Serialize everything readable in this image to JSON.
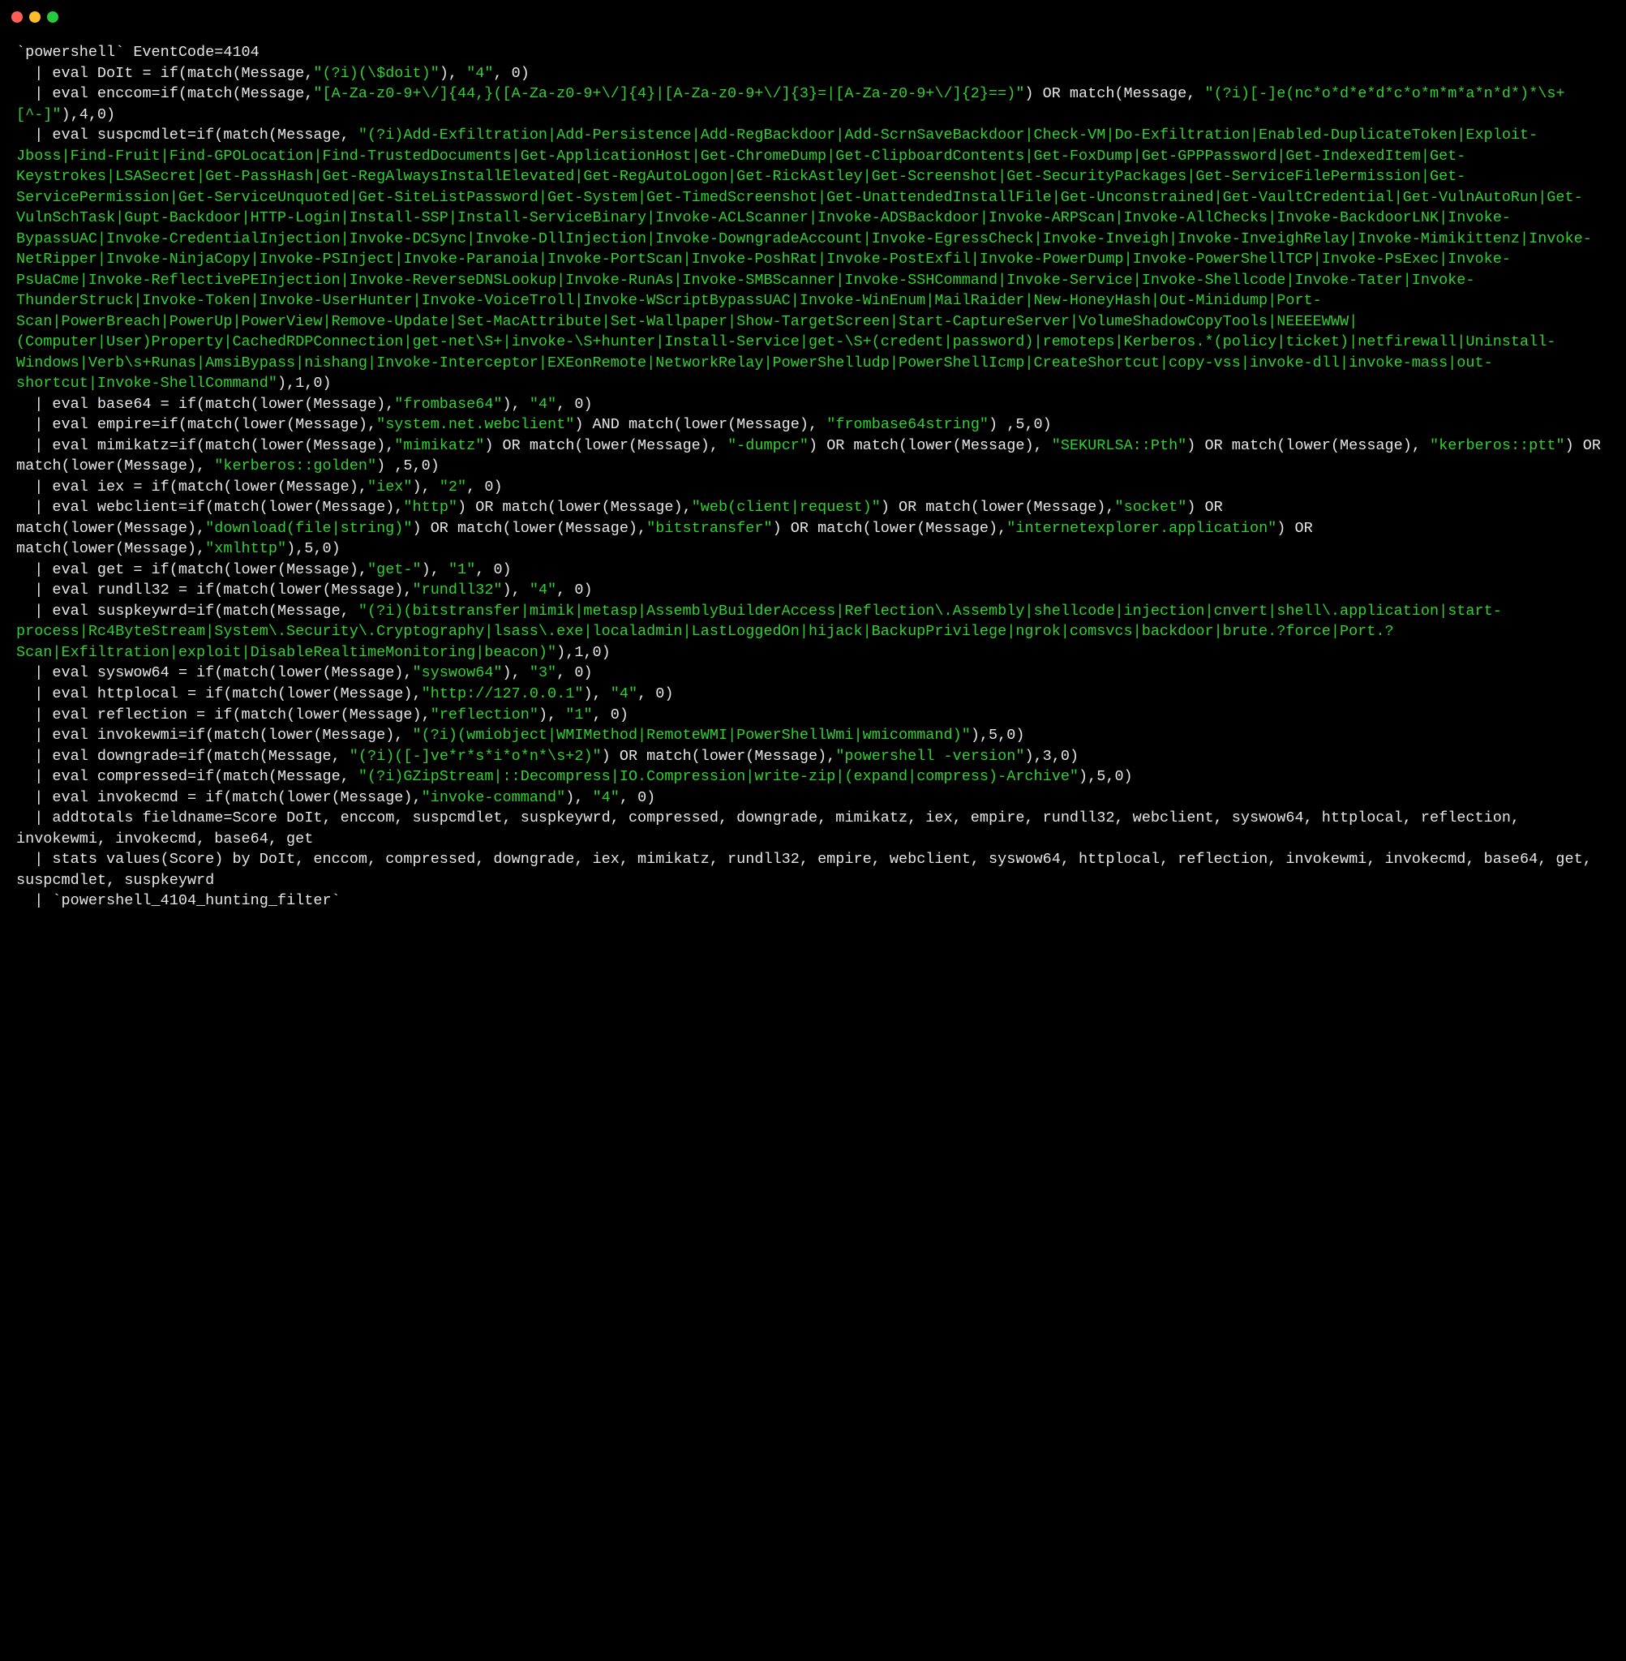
{
  "titlebar": {
    "close_name": "close",
    "min_name": "minimize",
    "max_name": "maximize"
  },
  "code": {
    "l1": "`powershell` EventCode=4104",
    "l2a": "  | eval DoIt = if(match(Message,",
    "l2q": "\"(?i)(\\$doit)\"",
    "l2b": "), ",
    "l2c": "\"4\"",
    "l2d": ", 0)",
    "l3a": "  | eval enccom=if(match(Message,",
    "l3q": "\"[A-Za-z0-9+\\/]{44,}([A-Za-z0-9+\\/]{4}|[A-Za-z0-9+\\/]{3}=|[A-Za-z0-9+\\/]{2}==)\"",
    "l3b": ") OR match(Message, ",
    "l3r": "\"(?i)[-]e(nc*o*d*e*d*c*o*m*m*a*n*d*)*\\s+[^-]\"",
    "l3c": "),4,0)",
    "l4a": "  | eval suspcmdlet=if(match(Message, ",
    "l4q": "\"(?i)Add-Exfiltration|Add-Persistence|Add-RegBackdoor|Add-ScrnSaveBackdoor|Check-VM|Do-Exfiltration|Enabled-DuplicateToken|Exploit-Jboss|Find-Fruit|Find-GPOLocation|Find-TrustedDocuments|Get-ApplicationHost|Get-ChromeDump|Get-ClipboardContents|Get-FoxDump|Get-GPPPassword|Get-IndexedItem|Get-Keystrokes|LSASecret|Get-PassHash|Get-RegAlwaysInstallElevated|Get-RegAutoLogon|Get-RickAstley|Get-Screenshot|Get-SecurityPackages|Get-ServiceFilePermission|Get-ServicePermission|Get-ServiceUnquoted|Get-SiteListPassword|Get-System|Get-TimedScreenshot|Get-UnattendedInstallFile|Get-Unconstrained|Get-VaultCredential|Get-VulnAutoRun|Get-VulnSchTask|Gupt-Backdoor|HTTP-Login|Install-SSP|Install-ServiceBinary|Invoke-ACLScanner|Invoke-ADSBackdoor|Invoke-ARPScan|Invoke-AllChecks|Invoke-BackdoorLNK|Invoke-BypassUAC|Invoke-CredentialInjection|Invoke-DCSync|Invoke-DllInjection|Invoke-DowngradeAccount|Invoke-EgressCheck|Invoke-Inveigh|Invoke-InveighRelay|Invoke-Mimikittenz|Invoke-NetRipper|Invoke-NinjaCopy|Invoke-PSInject|Invoke-Paranoia|Invoke-PortScan|Invoke-PoshRat|Invoke-PostExfil|Invoke-PowerDump|Invoke-PowerShellTCP|Invoke-PsExec|Invoke-PsUaCme|Invoke-ReflectivePEInjection|Invoke-ReverseDNSLookup|Invoke-RunAs|Invoke-SMBScanner|Invoke-SSHCommand|Invoke-Service|Invoke-Shellcode|Invoke-Tater|Invoke-ThunderStruck|Invoke-Token|Invoke-UserHunter|Invoke-VoiceTroll|Invoke-WScriptBypassUAC|Invoke-WinEnum|MailRaider|New-HoneyHash|Out-Minidump|Port-Scan|PowerBreach|PowerUp|PowerView|Remove-Update|Set-MacAttribute|Set-Wallpaper|Show-TargetScreen|Start-CaptureServer|VolumeShadowCopyTools|NEEEEWWW|(Computer|User)Property|CachedRDPConnection|get-net\\S+|invoke-\\S+hunter|Install-Service|get-\\S+(credent|password)|remoteps|Kerberos.*(policy|ticket)|netfirewall|Uninstall-Windows|Verb\\s+Runas|AmsiBypass|nishang|Invoke-Interceptor|EXEonRemote|NetworkRelay|PowerShelludp|PowerShellIcmp|CreateShortcut|copy-vss|invoke-dll|invoke-mass|out-shortcut|Invoke-ShellCommand\"",
    "l4b": "),1,0)",
    "l5a": "  | eval base64 = if(match(lower(Message),",
    "l5q": "\"frombase64\"",
    "l5b": "), ",
    "l5c": "\"4\"",
    "l5d": ", 0)",
    "l6a": "  | eval empire=if(match(lower(Message),",
    "l6q": "\"system.net.webclient\"",
    "l6b": ") AND match(lower(Message), ",
    "l6r": "\"frombase64string\"",
    "l6c": ") ,5,0)",
    "l7a": "  | eval mimikatz=if(match(lower(Message),",
    "l7q": "\"mimikatz\"",
    "l7b": ") OR match(lower(Message), ",
    "l7r": "\"-dumpcr\"",
    "l7c": ") OR match(lower(Message), ",
    "l7s": "\"SEKURLSA::Pth\"",
    "l7d": ") OR match(lower(Message), ",
    "l7t": "\"kerberos::ptt\"",
    "l7e": ") OR match(lower(Message), ",
    "l7u": "\"kerberos::golden\"",
    "l7f": ") ,5,0)",
    "l8a": "  | eval iex = if(match(lower(Message),",
    "l8q": "\"iex\"",
    "l8b": "), ",
    "l8c": "\"2\"",
    "l8d": ", 0)",
    "l9a": "  | eval webclient=if(match(lower(Message),",
    "l9q": "\"http\"",
    "l9b": ") OR match(lower(Message),",
    "l9r": "\"web(client|request)\"",
    "l9c": ") OR match(lower(Message),",
    "l9s": "\"socket\"",
    "l9d": ") OR match(lower(Message),",
    "l9t": "\"download(file|string)\"",
    "l9e": ") OR match(lower(Message),",
    "l9u": "\"bitstransfer\"",
    "l9f": ") OR match(lower(Message),",
    "l9v": "\"internetexplorer.application\"",
    "l9g": ") OR match(lower(Message),",
    "l9w": "\"xmlhttp\"",
    "l9h": "),5,0)",
    "l10a": "  | eval get = if(match(lower(Message),",
    "l10q": "\"get-\"",
    "l10b": "), ",
    "l10c": "\"1\"",
    "l10d": ", 0)",
    "l11a": "  | eval rundll32 = if(match(lower(Message),",
    "l11q": "\"rundll32\"",
    "l11b": "), ",
    "l11c": "\"4\"",
    "l11d": ", 0)",
    "l12a": "  | eval suspkeywrd=if(match(Message, ",
    "l12q": "\"(?i)(bitstransfer|mimik|metasp|AssemblyBuilderAccess|Reflection\\.Assembly|shellcode|injection|cnvert|shell\\.application|start-process|Rc4ByteStream|System\\.Security\\.Cryptography|lsass\\.exe|localadmin|LastLoggedOn|hijack|BackupPrivilege|ngrok|comsvcs|backdoor|brute.?force|Port.?Scan|Exfiltration|exploit|DisableRealtimeMonitoring|beacon)\"",
    "l12b": "),1,0)",
    "l13a": "  | eval syswow64 = if(match(lower(Message),",
    "l13q": "\"syswow64\"",
    "l13b": "), ",
    "l13c": "\"3\"",
    "l13d": ", 0)",
    "l14a": "  | eval httplocal = if(match(lower(Message),",
    "l14q": "\"http://127.0.0.1\"",
    "l14b": "), ",
    "l14c": "\"4\"",
    "l14d": ", 0)",
    "l15a": "  | eval reflection = if(match(lower(Message),",
    "l15q": "\"reflection\"",
    "l15b": "), ",
    "l15c": "\"1\"",
    "l15d": ", 0)",
    "l16a": "  | eval invokewmi=if(match(lower(Message), ",
    "l16q": "\"(?i)(wmiobject|WMIMethod|RemoteWMI|PowerShellWmi|wmicommand)\"",
    "l16b": "),5,0)",
    "l17a": "  | eval downgrade=if(match(Message, ",
    "l17q": "\"(?i)([-]ve*r*s*i*o*n*\\s+2)\"",
    "l17b": ") OR match(lower(Message),",
    "l17r": "\"powershell -version\"",
    "l17c": "),3,0)",
    "l18a": "  | eval compressed=if(match(Message, ",
    "l18q": "\"(?i)GZipStream|::Decompress|IO.Compression|write-zip|(expand|compress)-Archive\"",
    "l18b": "),5,0)",
    "l19a": "  | eval invokecmd = if(match(lower(Message),",
    "l19q": "\"invoke-command\"",
    "l19b": "), ",
    "l19c": "\"4\"",
    "l19d": ", 0)",
    "l20": "  | addtotals fieldname=Score DoIt, enccom, suspcmdlet, suspkeywrd, compressed, downgrade, mimikatz, iex, empire, rundll32, webclient, syswow64, httplocal, reflection, invokewmi, invokecmd, base64, get",
    "l21": "  | stats values(Score) by DoIt, enccom, compressed, downgrade, iex, mimikatz, rundll32, empire, webclient, syswow64, httplocal, reflection, invokewmi, invokecmd, base64, get, suspcmdlet, suspkeywrd",
    "l22": "  | `powershell_4104_hunting_filter`"
  }
}
